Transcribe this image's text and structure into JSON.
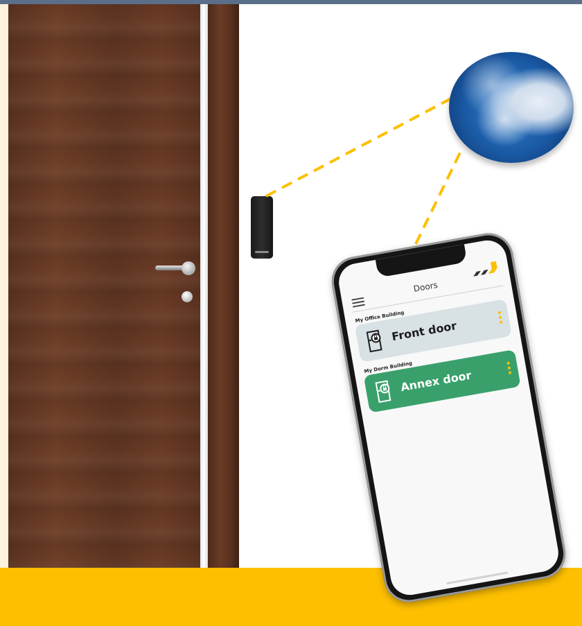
{
  "colors": {
    "accent": "#fdbf00",
    "door_active": "#3aa06b",
    "door_idle": "#d8e1e4"
  },
  "scene": {
    "door": "wooden-door",
    "reader": "card-reader",
    "globe": "globe-icon"
  },
  "app": {
    "title": "Doors",
    "menu_icon": "hamburger-menu-icon",
    "logo_icon": "brand-logo-icon",
    "groups": [
      {
        "label": "My Office Building",
        "door": {
          "label": "Front door",
          "state": "idle",
          "icon": "door-lock-icon"
        }
      },
      {
        "label": "My Dorm Building",
        "door": {
          "label": "Annex door",
          "state": "active",
          "icon": "door-lock-icon"
        }
      }
    ]
  }
}
